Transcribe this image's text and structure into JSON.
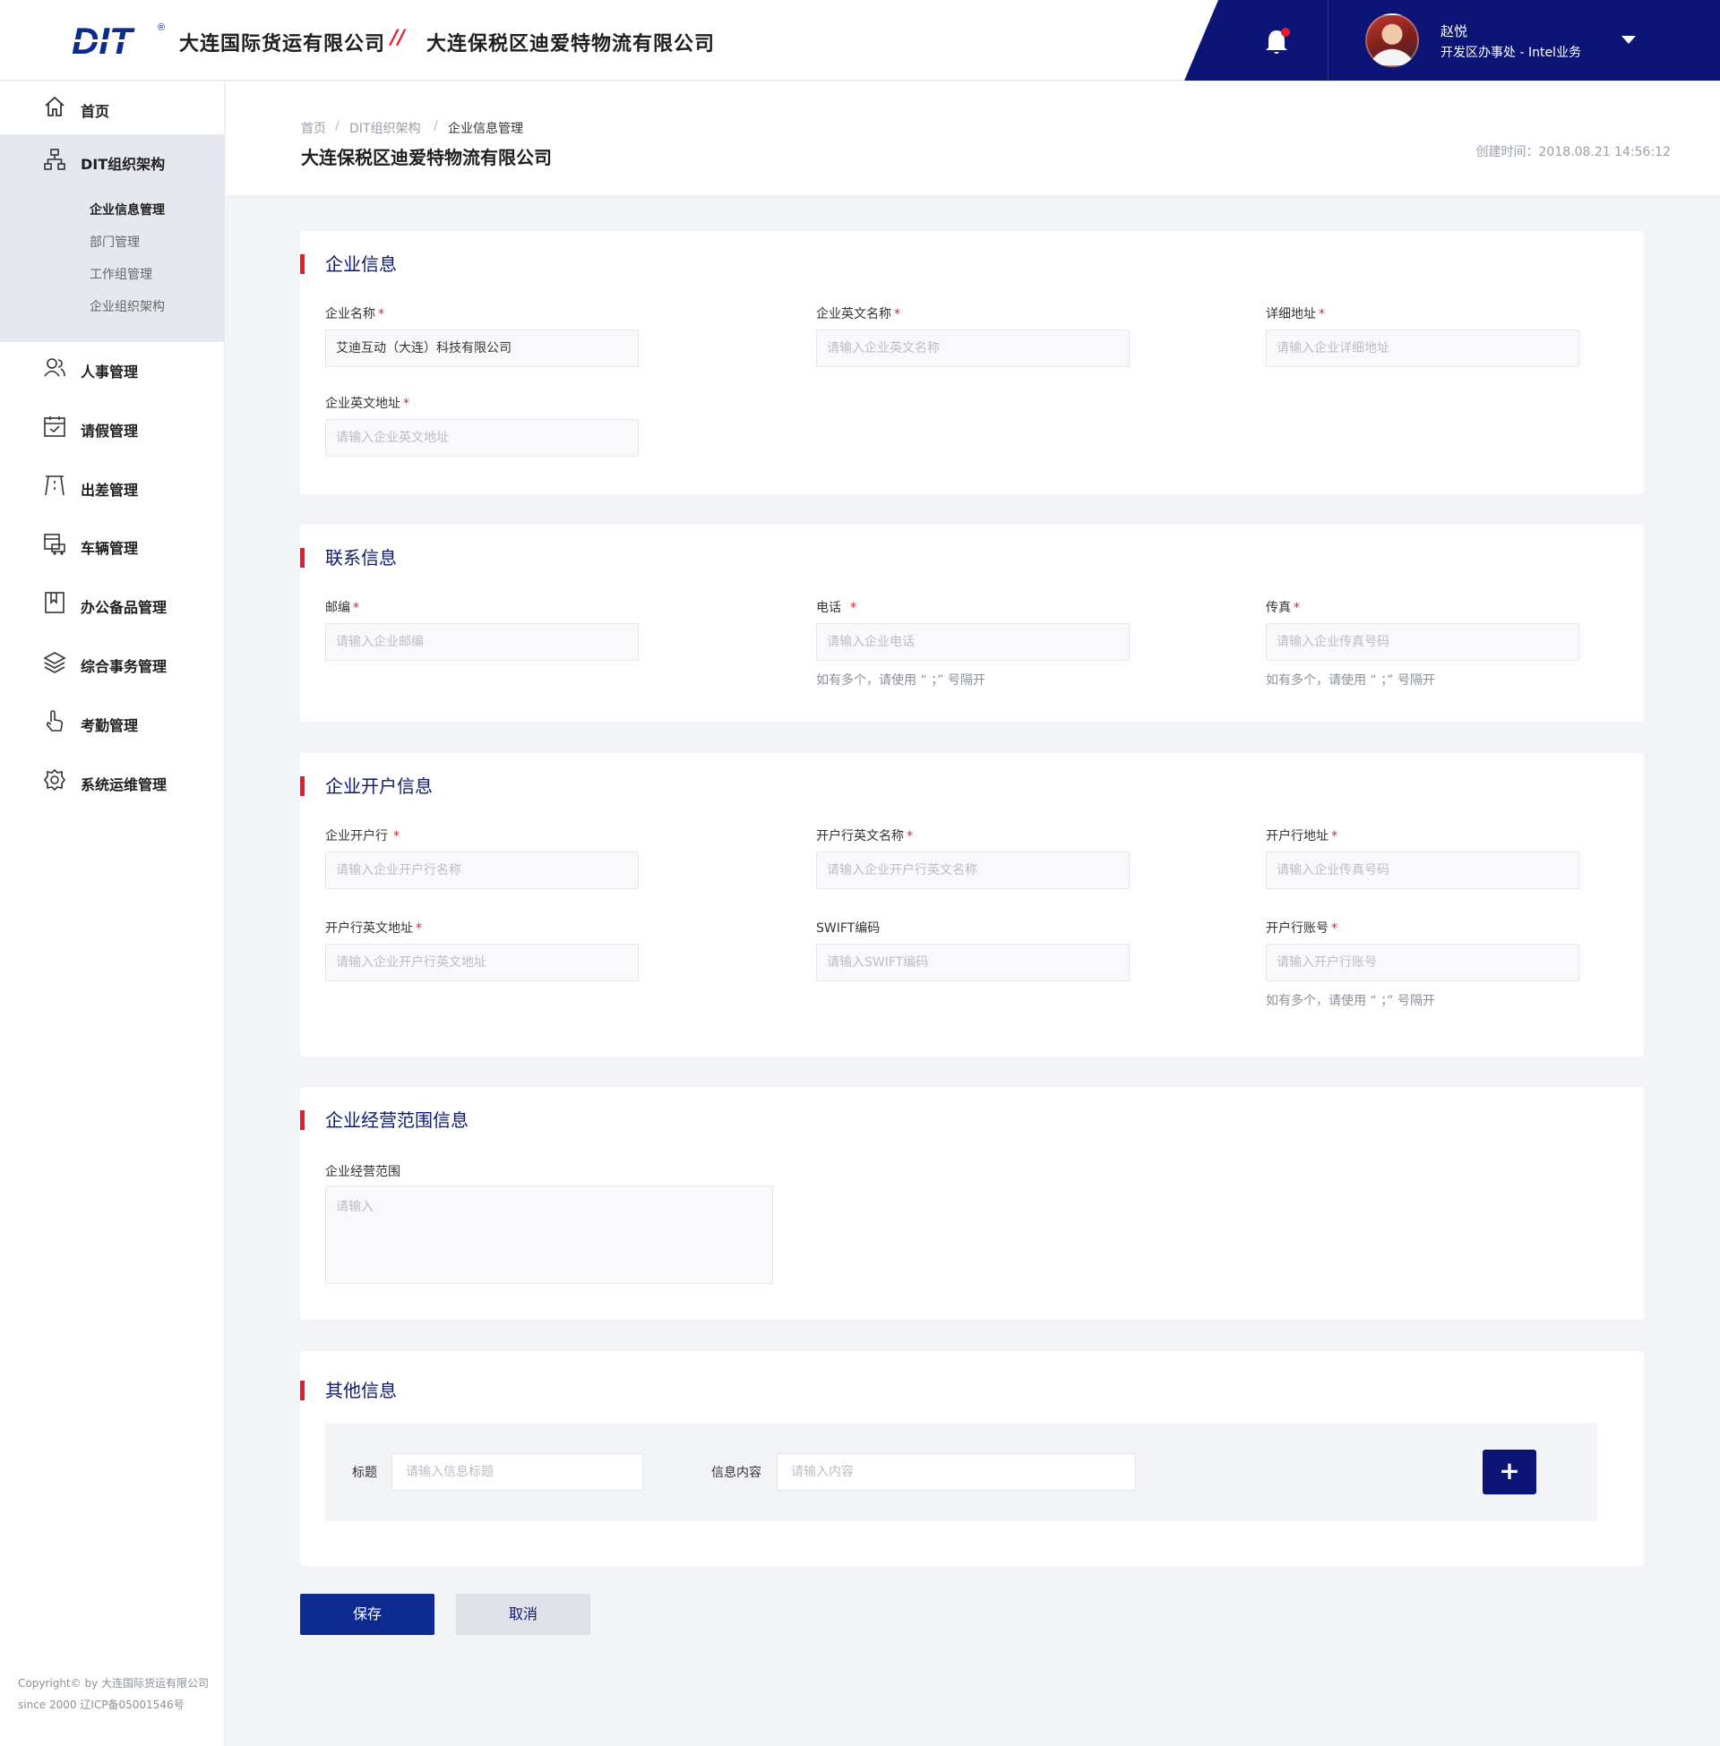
{
  "header": {
    "logo_text": "DIT",
    "logo_mark": "®",
    "company_primary": "大连国际货运有限公司",
    "separator": "//",
    "company_secondary": "大连保税区迪爱特物流有限公司",
    "bell_icon": "bell-icon",
    "user": {
      "name": "赵悦",
      "department": "开发区办事处 - Intel业务"
    },
    "accent_color": "#0c1575"
  },
  "sidebar": {
    "items": [
      {
        "label": "首页",
        "icon": "home-icon"
      },
      {
        "label": "DIT组织架构",
        "icon": "org-chart-icon"
      },
      {
        "label": "人事管理",
        "icon": "users-icon"
      },
      {
        "label": "请假管理",
        "icon": "calendar-icon"
      },
      {
        "label": "出差管理",
        "icon": "road-icon"
      },
      {
        "label": "车辆管理",
        "icon": "vehicle-icon"
      },
      {
        "label": "办公备品管理",
        "icon": "bookmark-icon"
      },
      {
        "label": "综合事务管理",
        "icon": "layers-icon"
      },
      {
        "label": "考勤管理",
        "icon": "hand-pointer-icon"
      },
      {
        "label": "系统运维管理",
        "icon": "settings-icon"
      }
    ],
    "org_sub_items": [
      {
        "label": "企业信息管理",
        "active": true
      },
      {
        "label": "部门管理",
        "active": false
      },
      {
        "label": "工作组管理",
        "active": false
      },
      {
        "label": "企业组织架构",
        "active": false
      }
    ],
    "copyright_line1": "Copyright© by 大连国际货运有限公司",
    "copyright_line2": "since 2000 辽ICP备05001546号"
  },
  "page": {
    "breadcrumb": [
      "首页",
      "DIT组织架构",
      "企业信息管理"
    ],
    "breadcrumb_sep": "/",
    "title": "大连保税区迪爱特物流有限公司",
    "created_time": "创建时间：2018.08.21  14:56:12"
  },
  "sections": {
    "company": {
      "title": "企业信息",
      "fields": [
        {
          "label": "企业名称",
          "value": "艾迪互动（大连）科技有限公司",
          "placeholder": "",
          "required": true
        },
        {
          "label": "企业英文名称",
          "value": "",
          "placeholder": "请输入企业英文名称",
          "required": true
        },
        {
          "label": "详细地址",
          "value": "",
          "placeholder": "请输入企业详细地址",
          "required": true
        },
        {
          "label": "企业英文地址",
          "value": "",
          "placeholder": "请输入企业英文地址",
          "required": true
        }
      ]
    },
    "contact": {
      "title": "联系信息",
      "fields": [
        {
          "label": "邮编",
          "placeholder": "请输入企业邮编",
          "required": true,
          "hint": ""
        },
        {
          "label": "电话",
          "placeholder": "请输入企业电话",
          "required": true,
          "hint": "如有多个，请使用 “ ；” 号隔开"
        },
        {
          "label": "传真",
          "placeholder": "请输入企业传真号码",
          "required": true,
          "hint": "如有多个，请使用 “ ；” 号隔开"
        }
      ]
    },
    "bank": {
      "title": "企业开户信息",
      "fields": [
        {
          "label": "企业开户行",
          "placeholder": "请输入企业开户行名称",
          "required": true,
          "hint": ""
        },
        {
          "label": "开户行英文名称",
          "placeholder": "请输入企业开户行英文名称",
          "required": true,
          "hint": ""
        },
        {
          "label": "开户行地址",
          "placeholder": "请输入企业传真号码",
          "required": true,
          "hint": ""
        },
        {
          "label": "开户行英文地址",
          "placeholder": "请输入企业开户行英文地址",
          "required": true,
          "hint": ""
        },
        {
          "label": "SWIFT编码",
          "placeholder": "请输入SWIFT编码",
          "required": false,
          "hint": ""
        },
        {
          "label": "开户行账号",
          "placeholder": "请输入开户行账号",
          "required": true,
          "hint": "如有多个，请使用 “ ；” 号隔开"
        }
      ]
    },
    "scope": {
      "title": "企业经营范围信息",
      "field_label": "企业经营范围",
      "placeholder": "请输入"
    },
    "other": {
      "title": "其他信息",
      "title_label": "标题",
      "title_placeholder": "请输入信息标题",
      "content_label": "信息内容",
      "content_placeholder": "请输入内容",
      "add_label": "+"
    }
  },
  "actions": {
    "save_label": "保存",
    "cancel_label": "取消"
  },
  "required_mark": "*"
}
